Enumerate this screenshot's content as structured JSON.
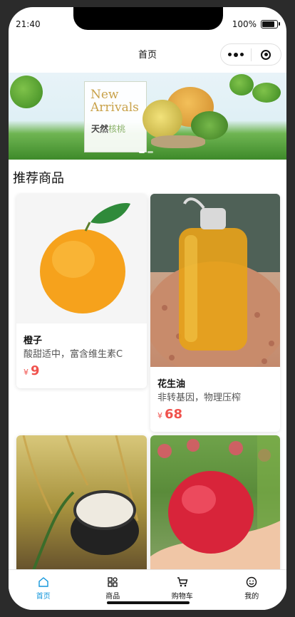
{
  "status_bar": {
    "time": "21:40",
    "battery_text": "100%",
    "battery_level": 1.0
  },
  "nav": {
    "title": "首页"
  },
  "banner": {
    "headline": "New Arrivals",
    "subtitle_main": "天然",
    "subtitle_accent": "核桃",
    "slide_count": 2,
    "active_slide": 1
  },
  "section": {
    "title": "推荐商品"
  },
  "products": [
    {
      "name": "橙子",
      "desc": "酸甜适中，富含维生素C",
      "currency": "¥",
      "price": "9",
      "image_icon": "orange-image"
    },
    {
      "name": "花生油",
      "desc": "非转基因，物理压榨",
      "currency": "¥",
      "price": "68",
      "image_icon": "peanut-oil-image"
    },
    {
      "name": "",
      "desc": "",
      "currency": "",
      "price": "",
      "image_icon": "rice-image"
    },
    {
      "name": "",
      "desc": "",
      "currency": "",
      "price": "",
      "image_icon": "apple-image"
    }
  ],
  "tabbar": [
    {
      "label": "首页",
      "icon": "home-icon",
      "active": true
    },
    {
      "label": "商品",
      "icon": "category-icon",
      "active": false
    },
    {
      "label": "购物车",
      "icon": "cart-icon",
      "active": false
    },
    {
      "label": "我的",
      "icon": "smile-icon",
      "active": false
    }
  ],
  "colors": {
    "accent": "#1296db",
    "price": "#f0524d"
  }
}
